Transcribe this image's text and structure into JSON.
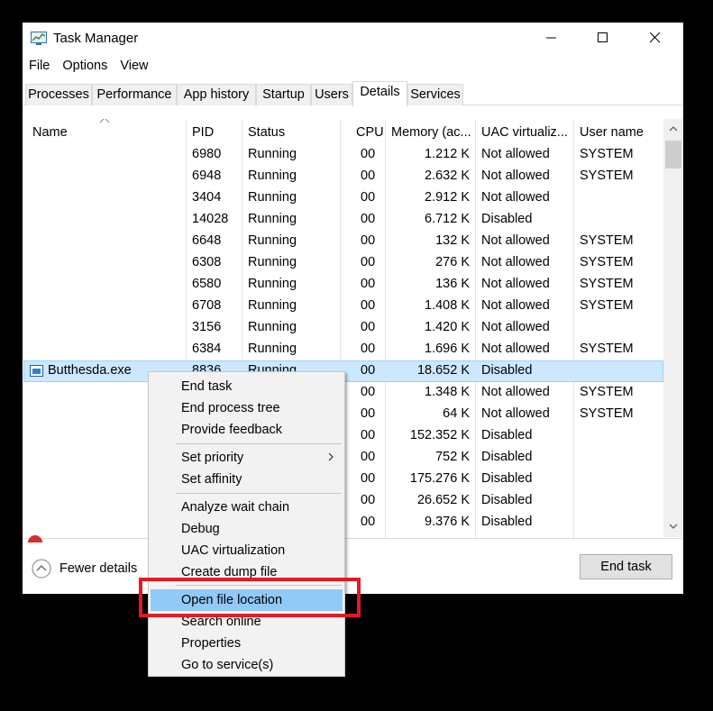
{
  "window": {
    "title": "Task Manager"
  },
  "menubar": [
    "File",
    "Options",
    "View"
  ],
  "tabs": [
    {
      "label": "Processes"
    },
    {
      "label": "Performance"
    },
    {
      "label": "App history"
    },
    {
      "label": "Startup"
    },
    {
      "label": "Users"
    },
    {
      "label": "Details",
      "active": true
    },
    {
      "label": "Services"
    }
  ],
  "columns": [
    "Name",
    "PID",
    "Status",
    "CPU",
    "Memory (ac...",
    "UAC virtualiz...",
    "User name"
  ],
  "rows": [
    {
      "name": "",
      "pid": "6980",
      "status": "Running",
      "cpu": "00",
      "memory": "1.212 K",
      "uac": "Not allowed",
      "user": "SYSTEM"
    },
    {
      "name": "",
      "pid": "6948",
      "status": "Running",
      "cpu": "00",
      "memory": "2.632 K",
      "uac": "Not allowed",
      "user": "SYSTEM"
    },
    {
      "name": "",
      "pid": "3404",
      "status": "Running",
      "cpu": "00",
      "memory": "2.912 K",
      "uac": "Not allowed",
      "user": ""
    },
    {
      "name": "",
      "pid": "14028",
      "status": "Running",
      "cpu": "00",
      "memory": "6.712 K",
      "uac": "Disabled",
      "user": ""
    },
    {
      "name": "",
      "pid": "6648",
      "status": "Running",
      "cpu": "00",
      "memory": "132 K",
      "uac": "Not allowed",
      "user": "SYSTEM"
    },
    {
      "name": "",
      "pid": "6308",
      "status": "Running",
      "cpu": "00",
      "memory": "276 K",
      "uac": "Not allowed",
      "user": "SYSTEM"
    },
    {
      "name": "",
      "pid": "6580",
      "status": "Running",
      "cpu": "00",
      "memory": "136 K",
      "uac": "Not allowed",
      "user": "SYSTEM"
    },
    {
      "name": "",
      "pid": "6708",
      "status": "Running",
      "cpu": "00",
      "memory": "1.408 K",
      "uac": "Not allowed",
      "user": "SYSTEM"
    },
    {
      "name": "",
      "pid": "3156",
      "status": "Running",
      "cpu": "00",
      "memory": "1.420 K",
      "uac": "Not allowed",
      "user": ""
    },
    {
      "name": "",
      "pid": "6384",
      "status": "Running",
      "cpu": "00",
      "memory": "1.696 K",
      "uac": "Not allowed",
      "user": "SYSTEM"
    },
    {
      "name": "Butthesda.exe",
      "pid": "8836",
      "status": "Running",
      "cpu": "00",
      "memory": "18.652 K",
      "uac": "Disabled",
      "user": "",
      "selected": true
    },
    {
      "name": "",
      "pid": "",
      "status": "",
      "cpu": "00",
      "memory": "1.348 K",
      "uac": "Not allowed",
      "user": "SYSTEM"
    },
    {
      "name": "",
      "pid": "",
      "status": "",
      "cpu": "00",
      "memory": "64 K",
      "uac": "Not allowed",
      "user": "SYSTEM"
    },
    {
      "name": "",
      "pid": "",
      "status": "",
      "cpu": "00",
      "memory": "152.352 K",
      "uac": "Disabled",
      "user": ""
    },
    {
      "name": "",
      "pid": "",
      "status": "",
      "cpu": "00",
      "memory": "752 K",
      "uac": "Disabled",
      "user": ""
    },
    {
      "name": "",
      "pid": "",
      "status": "",
      "cpu": "00",
      "memory": "175.276 K",
      "uac": "Disabled",
      "user": ""
    },
    {
      "name": "",
      "pid": "",
      "status": "",
      "cpu": "00",
      "memory": "26.652 K",
      "uac": "Disabled",
      "user": ""
    },
    {
      "name": "",
      "pid": "",
      "status": "",
      "cpu": "00",
      "memory": "9.376 K",
      "uac": "Disabled",
      "user": ""
    }
  ],
  "footer": {
    "fewer_details": "Fewer details",
    "end_task": "End task"
  },
  "context_menu": {
    "groups": [
      [
        "End task",
        "End process tree",
        "Provide feedback"
      ],
      [
        "Set priority",
        "Set affinity"
      ],
      [
        "Analyze wait chain",
        "Debug",
        "UAC virtualization",
        "Create dump file"
      ],
      [
        "Open file location",
        "Search online",
        "Properties",
        "Go to service(s)"
      ]
    ],
    "highlighted": "Open file location",
    "submenu_item": "Set priority"
  },
  "colors": {
    "selection": "#cce8ff",
    "menu_hover": "#91c9f7",
    "annotation": "#e01b24"
  }
}
